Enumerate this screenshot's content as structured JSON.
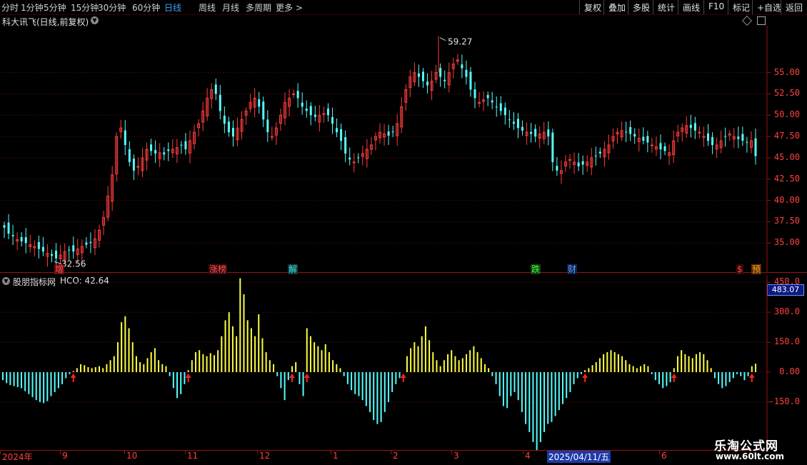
{
  "toolbar": {
    "periods": [
      "分时",
      "1分钟",
      "5分钟",
      "15分钟",
      "30分钟",
      "60分钟",
      "日线",
      "周线",
      "月线",
      "多周期",
      "更多 >"
    ],
    "active_period": "日线",
    "right_buttons": [
      "复权",
      "叠加",
      "多股",
      "统计",
      "画线",
      "F10",
      "标记",
      "+自选",
      "返回"
    ]
  },
  "main_chart": {
    "title": "科大讯飞(日线,前复权)",
    "y_ticks": [
      "55.00",
      "52.50",
      "50.00",
      "47.50",
      "45.00",
      "42.50",
      "40.00",
      "37.50",
      "35.00"
    ],
    "high_label": "59.27",
    "low_label": "32.56",
    "event_tags": [
      {
        "text": "增",
        "color": "#ff5050",
        "bg": "#6a1010"
      },
      {
        "text": "涨榜",
        "color": "#ff5050",
        "bg": "#3a0a0a"
      },
      {
        "text": "解",
        "color": "#40e0e0",
        "bg": "#103a3a"
      },
      {
        "text": "跌",
        "color": "#40ff40",
        "bg": "#104010"
      },
      {
        "text": "财",
        "color": "#5aa0ff",
        "bg": "#10204a"
      },
      {
        "text": "$",
        "color": "#ff4040",
        "bg": "#3a0a0a"
      },
      {
        "text": "预",
        "color": "#ffa030",
        "bg": "#5a3000"
      }
    ]
  },
  "indicator": {
    "name": "股朋指标网",
    "value_label": "HCO: 42.64",
    "y_ticks": [
      "450.0",
      "300.0",
      "150.0",
      "0.00",
      "-150.0"
    ],
    "cursor_value": "483.07",
    "buy_arrows": 19
  },
  "x_axis": {
    "labels": [
      "2024年",
      "9",
      "10",
      "11",
      "12",
      "1",
      "2",
      "3",
      "4",
      "6"
    ],
    "cursor_date": "2025/04/11/五"
  },
  "watermark": {
    "line1": "乐淘公式网",
    "line2": "www.60lt.com"
  },
  "colors": {
    "up": "#ff3c3c",
    "down": "#54ffff",
    "positive_bar": "#ffff40",
    "negative_bar": "#54ffff",
    "arrow": "#ff2020",
    "axis": "#a01010"
  },
  "chart_data": {
    "type": "candlestick",
    "price_series": {
      "name": "",
      "close": [
        36.8,
        36.1,
        35.8,
        35.4,
        35.2,
        35.0,
        34.8,
        34.6,
        34.3,
        34.0,
        33.8,
        33.5,
        33.2,
        33.6,
        34.0,
        34.2,
        34.0,
        34.3,
        34.6,
        34.8,
        35.0,
        35.5,
        36.5,
        38.0,
        40.5,
        43.0,
        47.5,
        48.5,
        46.5,
        44.5,
        43.5,
        44.0,
        45.0,
        46.0,
        45.8,
        45.5,
        45.6,
        45.4,
        45.8,
        46.0,
        46.2,
        46.5,
        46.0,
        47.0,
        48.0,
        49.0,
        50.5,
        52.0,
        53.0,
        52.5,
        50.5,
        49.0,
        48.0,
        47.5,
        48.5,
        49.5,
        50.5,
        51.5,
        52.0,
        51.0,
        49.5,
        48.0,
        47.5,
        48.5,
        50.0,
        51.5,
        52.0,
        52.5,
        52.0,
        51.0,
        50.5,
        50.0,
        49.8,
        50.0,
        50.2,
        50.0,
        49.0,
        48.0,
        47.0,
        45.5,
        44.8,
        44.5,
        45.0,
        45.5,
        46.0,
        46.5,
        47.5,
        48.0,
        47.8,
        47.6,
        48.0,
        49.0,
        51.0,
        53.0,
        54.5,
        55.0,
        54.5,
        54.0,
        53.5,
        54.0,
        55.0,
        54.5,
        54.0,
        55.0,
        56.0,
        56.5,
        55.5,
        54.5,
        53.0,
        52.0,
        51.5,
        51.8,
        52.0,
        51.5,
        51.0,
        50.5,
        50.0,
        49.5,
        49.0,
        48.5,
        48.2,
        48.0,
        47.8,
        47.5,
        47.8,
        48.0,
        47.5,
        44.5,
        43.5,
        43.5,
        44.5,
        44.8,
        44.5,
        44.0,
        44.2,
        44.5,
        45.0,
        45.2,
        45.5,
        46.0,
        46.5,
        47.5,
        48.0,
        48.2,
        48.0,
        47.8,
        47.5,
        47.3,
        47.0,
        46.8,
        46.5,
        46.3,
        46.0,
        45.8,
        45.6,
        47.0,
        48.0,
        48.5,
        48.8,
        48.5,
        48.2,
        48.0,
        47.5,
        47.0,
        46.5,
        46.5,
        47.0,
        47.5,
        47.8,
        47.5,
        47.2,
        47.0,
        46.8,
        47.0,
        45.2
      ],
      "high": 59.27,
      "low": 32.56
    },
    "hco_series": {
      "name": "HCO",
      "values": [
        -40,
        -55,
        -65,
        -70,
        -75,
        -80,
        -95,
        -110,
        -125,
        -140,
        -150,
        -155,
        -145,
        -120,
        -100,
        -80,
        -60,
        -30,
        -10,
        5,
        20,
        40,
        35,
        25,
        20,
        25,
        30,
        20,
        40,
        60,
        80,
        150,
        250,
        280,
        220,
        150,
        80,
        50,
        40,
        70,
        100,
        120,
        60,
        40,
        30,
        -20,
        -80,
        -130,
        -110,
        -60,
        10,
        60,
        100,
        110,
        90,
        80,
        95,
        85,
        110,
        180,
        260,
        300,
        230,
        180,
        470,
        390,
        260,
        220,
        180,
        290,
        170,
        100,
        60,
        40,
        -20,
        -80,
        -140,
        -40,
        30,
        50,
        -60,
        -120,
        220,
        180,
        150,
        130,
        110,
        140,
        100,
        60,
        40,
        20,
        -20,
        -60,
        -90,
        -110,
        -120,
        -140,
        -170,
        -200,
        -240,
        -260,
        -250,
        -200,
        -150,
        -100,
        -60,
        -30,
        0,
        80,
        120,
        150,
        130,
        180,
        230,
        160,
        100,
        60,
        30,
        60,
        90,
        110,
        80,
        60,
        70,
        90,
        110,
        130,
        100,
        70,
        40,
        20,
        -20,
        -60,
        -120,
        -170,
        -180,
        -120,
        -100,
        -140,
        -200,
        -260,
        -300,
        -350,
        -400,
        -350,
        -300,
        -260,
        -250,
        -220,
        -190,
        -160,
        -130,
        -100,
        -60,
        -30,
        -10,
        10,
        20,
        35,
        50,
        70,
        90,
        100,
        110,
        100,
        90,
        80,
        60,
        40,
        30,
        20,
        30,
        40,
        30,
        -10,
        -40,
        -60,
        -80,
        -70,
        -50,
        20,
        80,
        110,
        90,
        80,
        70,
        90,
        100,
        90,
        60,
        20,
        -30,
        -60,
        -80,
        -70,
        -50,
        -30,
        -10,
        -20,
        -40,
        -20,
        30,
        42.64
      ],
      "ylim": [
        -390,
        483.07
      ]
    },
    "x_labels": [
      "2024年",
      "9",
      "10",
      "11",
      "12",
      "1",
      "2",
      "3",
      "4",
      "6"
    ]
  }
}
